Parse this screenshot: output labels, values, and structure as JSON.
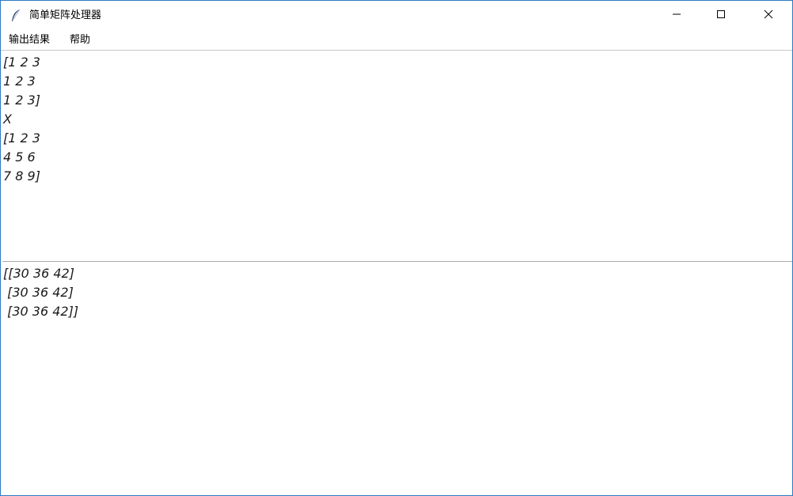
{
  "window": {
    "title": "简单矩阵处理器",
    "controls": {
      "minimize_icon": "minimize-icon",
      "maximize_icon": "maximize-icon",
      "close_icon": "close-icon"
    },
    "app_icon": "feather-icon",
    "border_color": "#2b79c2"
  },
  "menubar": {
    "items": [
      {
        "label": "输出结果"
      },
      {
        "label": "帮助"
      }
    ]
  },
  "input_pane": {
    "lines": [
      "[1 2 3",
      "1 2 3",
      "1 2 3]",
      "X",
      "[1 2 3",
      "4 5 6",
      "7 8 9]"
    ]
  },
  "output_pane": {
    "lines": [
      "[[30 36 42]",
      " [30 36 42]",
      " [30 36 42]]"
    ]
  }
}
